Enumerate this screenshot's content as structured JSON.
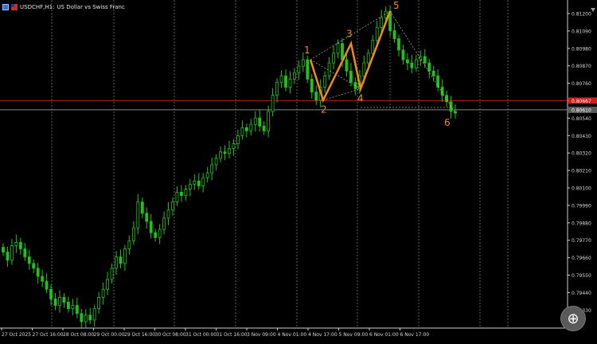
{
  "header": {
    "symbol": "USDCHF,H1:",
    "description": "US Dollar vs Swiss Franc"
  },
  "colors": {
    "background": "#000000",
    "candle": "#21c21b",
    "axis_text": "#d8d8d8",
    "grid": "#c8c8c8",
    "pattern": "#f08a1a",
    "pattern_label": "#f08a1a",
    "red_line": "#c01818",
    "gray_line": "#8a8a8a",
    "red_tag": "#d01c1c",
    "gray_tag": "#5a5a5a"
  },
  "icons": {
    "zoom": "zoom-icon",
    "window": "window-icon"
  },
  "zoom_glyph": "⊕",
  "price_axis": {
    "labels": [
      "0.81200",
      "0.81090",
      "0.80980",
      "0.80870",
      "0.80760",
      "0.80650",
      "0.80540",
      "0.80430",
      "0.80320",
      "0.80210",
      "0.80100",
      "0.79990",
      "0.79880",
      "0.79770",
      "0.79660",
      "0.79550",
      "0.79440",
      "0.79330"
    ],
    "min": 0.7926,
    "max": 0.8125,
    "current_bid_tag": "0.80667",
    "current_ask_tag": "0.80610"
  },
  "time_axis": {
    "labels": [
      "27 Oct 2025",
      "27 Oct 16:00",
      "28 Oct 08:00",
      "29 Oct 00:00",
      "29 Oct 16:00",
      "30 Oct 08:00",
      "31 Oct 00:00",
      "31 Oct 16:00",
      "3 Nov 09:00",
      "4 Nov 01:00",
      "4 Nov 17:00",
      "5 Nov 09:00",
      "6 Nov 01:00",
      "6 Nov 17:00"
    ]
  },
  "pattern": {
    "labels": [
      "1",
      "2",
      "3",
      "4",
      "5",
      "6"
    ],
    "prices": [
      0.8092,
      0.8067,
      0.8102,
      0.8074,
      0.8122,
      0.8059
    ]
  },
  "levels": {
    "red": 0.80667,
    "gray": 0.8061
  },
  "chart_data": {
    "type": "candlestick",
    "title": "",
    "series": [
      {
        "close": [
          0.7973,
          0.7968,
          0.7977,
          0.7979,
          0.7975,
          0.797,
          0.7966,
          0.7963,
          0.7958,
          0.7955,
          0.795,
          0.7944,
          0.794,
          0.7945,
          0.7942,
          0.7938,
          0.794,
          0.7935,
          0.793,
          0.7934,
          0.7931,
          0.7938,
          0.7945,
          0.795,
          0.7956,
          0.7963,
          0.797,
          0.7966,
          0.7975,
          0.798,
          0.7988,
          0.8004,
          0.7997,
          0.7992,
          0.7985,
          0.7982,
          0.7987,
          0.7994,
          0.7999,
          0.8004,
          0.801,
          0.8008,
          0.8012,
          0.8015,
          0.8017,
          0.8014,
          0.8019,
          0.8022,
          0.8027,
          0.8031,
          0.8035,
          0.8034,
          0.8037,
          0.804,
          0.8045,
          0.805,
          0.8048,
          0.8052,
          0.8056,
          0.8051,
          0.8048,
          0.806,
          0.807,
          0.8078,
          0.8082,
          0.8075,
          0.808,
          0.8084,
          0.8088,
          0.8092,
          0.808,
          0.8072,
          0.8067,
          0.8075,
          0.8082,
          0.809,
          0.8096,
          0.8102,
          0.8092,
          0.8085,
          0.8078,
          0.8074,
          0.8082,
          0.809,
          0.8096,
          0.8104,
          0.8112,
          0.8118,
          0.8122,
          0.811,
          0.8105,
          0.8098,
          0.8092,
          0.809,
          0.8087,
          0.8092,
          0.8094,
          0.809,
          0.8085,
          0.8082,
          0.8075,
          0.807,
          0.8066,
          0.806,
          0.8059
        ]
      }
    ],
    "ylim": [
      0.7926,
      0.8125
    ]
  }
}
